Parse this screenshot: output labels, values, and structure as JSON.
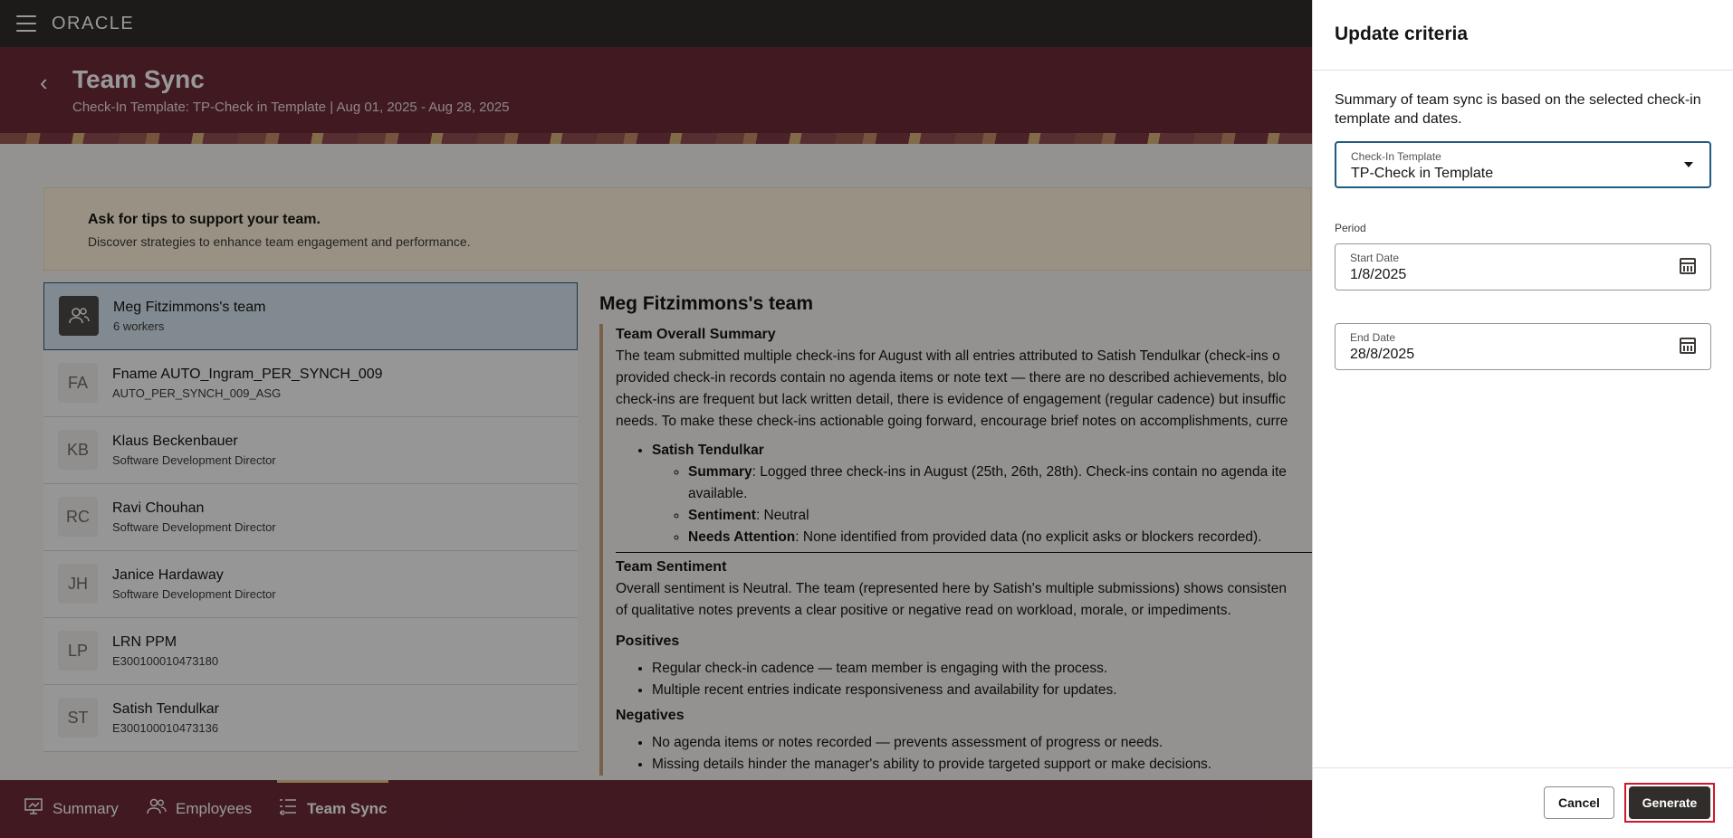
{
  "app": {
    "logo": "ORACLE"
  },
  "hero": {
    "title": "Team Sync",
    "subtitle": "Check-In Template: TP-Check in Template | Aug 01, 2025 - Aug 28, 2025"
  },
  "tips": {
    "title": "Ask for tips to support your team.",
    "text": "Discover strategies to enhance team engagement and performance."
  },
  "team_list": [
    {
      "initials": "",
      "name": "Meg Fitzimmons's team",
      "sub": "6 workers",
      "selected": true
    },
    {
      "initials": "FA",
      "name": "Fname AUTO_Ingram_PER_SYNCH_009",
      "sub": "AUTO_PER_SYNCH_009_ASG"
    },
    {
      "initials": "KB",
      "name": "Klaus Beckenbauer",
      "sub": "Software Development Director"
    },
    {
      "initials": "RC",
      "name": "Ravi Chouhan",
      "sub": "Software Development Director"
    },
    {
      "initials": "JH",
      "name": "Janice Hardaway",
      "sub": "Software Development Director"
    },
    {
      "initials": "LP",
      "name": "LRN PPM",
      "sub": "E300100010473180"
    },
    {
      "initials": "ST",
      "name": "Satish Tendulkar",
      "sub": "E300100010473136"
    }
  ],
  "detail": {
    "title": "Meg Fitzimmons's team",
    "overall_heading": "Team Overall Summary",
    "overall_lines": [
      "The team submitted multiple check-ins for August with all entries attributed to Satish Tendulkar (check-ins o",
      "provided check-in records contain no agenda items or note text — there are no described achievements, blo",
      "check-ins are frequent but lack written detail, there is evidence of engagement (regular cadence) but insuffic",
      "needs. To make these check-ins actionable going forward, encourage brief notes on accomplishments, curre"
    ],
    "member_name": "Satish Tendulkar",
    "summary_label": "Summary",
    "summary_text": ": Logged three check-ins in August (25th, 26th, 28th). Check-ins contain no agenda ite",
    "summary_cont": "available.",
    "sentiment_label": "Sentiment",
    "sentiment_text": ": Neutral",
    "needs_label": "Needs Attention",
    "needs_text": ": None identified from provided data (no explicit asks or blockers recorded).",
    "sentiment_heading": "Team Sentiment",
    "sentiment_lines": [
      "Overall sentiment is Neutral. The team (represented here by Satish's multiple submissions) shows consisten",
      "of qualitative notes prevents a clear positive or negative read on workload, morale, or impediments."
    ],
    "positives_heading": "Positives",
    "positives": [
      "Regular check-in cadence — team member is engaging with the process.",
      "Multiple recent entries indicate responsiveness and availability for updates."
    ],
    "negatives_heading": "Negatives",
    "negatives": [
      "No agenda items or notes recorded — prevents assessment of progress or needs.",
      "Missing details hinder the manager's ability to provide targeted support or make decisions."
    ]
  },
  "bottom_nav": [
    {
      "label": "Summary",
      "icon": "presentation-icon",
      "active": false
    },
    {
      "label": "Employees",
      "icon": "people-icon",
      "active": false
    },
    {
      "label": "Team Sync",
      "icon": "list-settings-icon",
      "active": true
    }
  ],
  "drawer": {
    "title": "Update criteria",
    "description": "Summary of team sync is based on the selected check-in template and dates.",
    "template_label": "Check-In Template",
    "template_value": "TP-Check in Template",
    "period_label": "Period",
    "start_label": "Start Date",
    "start_value": "1/8/2025",
    "end_label": "End Date",
    "end_value": "28/8/2025",
    "cancel_label": "Cancel",
    "generate_label": "Generate"
  },
  "colors": {
    "hero": "#6d2a38",
    "topbar": "#312d2a",
    "focus": "#1f5a82",
    "highlight": "#d0162b"
  }
}
